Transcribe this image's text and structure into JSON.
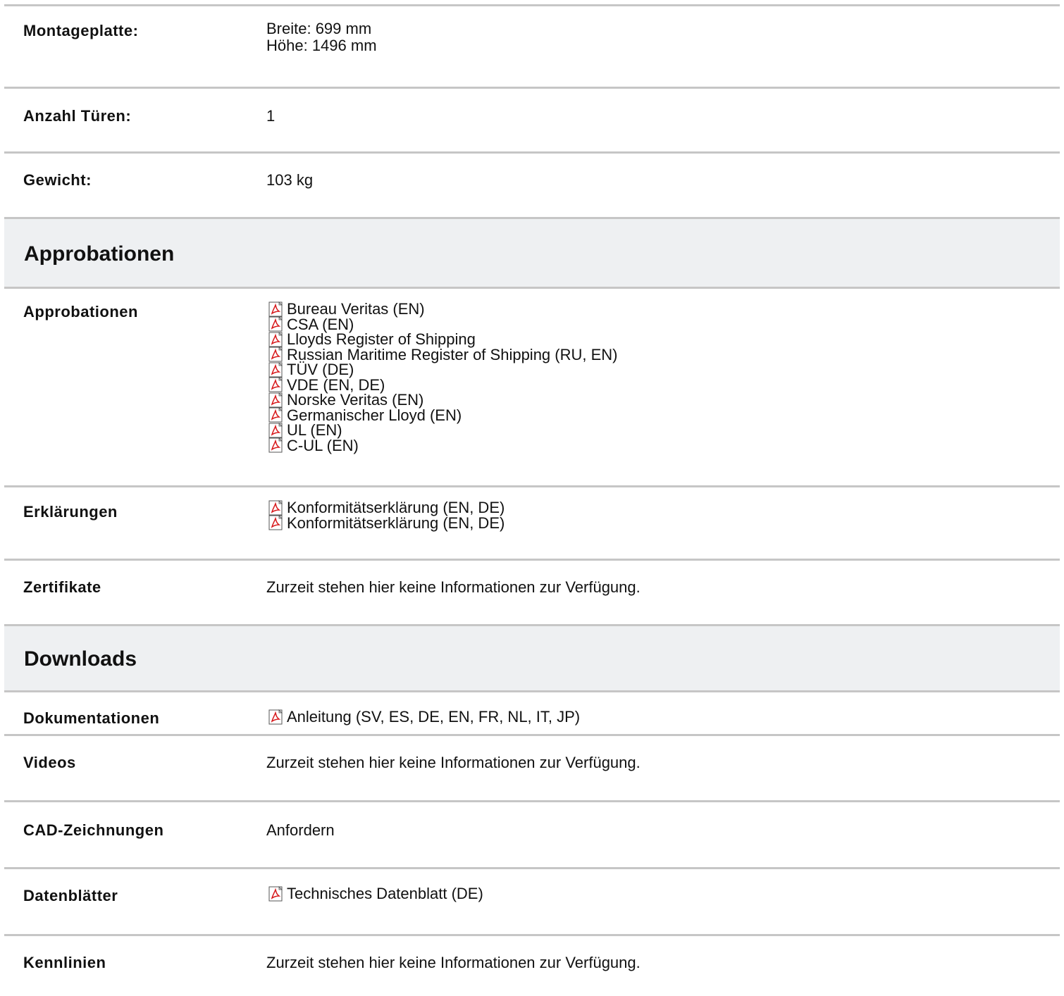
{
  "specs": {
    "mounting_plate": {
      "label": "Montageplatte:",
      "width": "Breite: 699 mm",
      "height": "Höhe: 1496 mm"
    },
    "doors": {
      "label": "Anzahl Türen:",
      "value": "1"
    },
    "weight": {
      "label": "Gewicht:",
      "value": "103 kg"
    }
  },
  "approvals_section": {
    "title": "Approbationen",
    "approvals": {
      "label": "Approbationen",
      "items": [
        "Bureau Veritas (EN)",
        "CSA (EN)",
        "Lloyds Register of Shipping",
        "Russian Maritime Register of Shipping (RU, EN)",
        "TÜV (DE)",
        "VDE (EN, DE)",
        "Norske Veritas (EN)",
        "Germanischer Lloyd (EN)",
        "UL (EN)",
        "C-UL (EN)"
      ]
    },
    "declarations": {
      "label": "Erklärungen",
      "items": [
        "Konformitätserklärung (EN, DE)",
        "Konformitätserklärung (EN, DE)"
      ]
    },
    "certificates": {
      "label": "Zertifikate",
      "value": "Zurzeit stehen hier keine Informationen zur Verfügung."
    }
  },
  "downloads_section": {
    "title": "Downloads",
    "documentation": {
      "label": "Dokumentationen",
      "items": [
        "Anleitung (SV, ES, DE, EN, FR, NL, IT, JP)"
      ]
    },
    "videos": {
      "label": "Videos",
      "value": "Zurzeit stehen hier keine Informationen zur Verfügung."
    },
    "cad": {
      "label": "CAD-Zeichnungen",
      "value": "Anfordern"
    },
    "datasheets": {
      "label": "Datenblätter",
      "items": [
        "Technisches Datenblatt (DE)"
      ]
    },
    "characteristics": {
      "label": "Kennlinien",
      "value": "Zurzeit stehen hier keine Informationen zur Verfügung."
    }
  },
  "icons": {
    "pdf": "pdf-icon",
    "pdf_color": "#d7191c"
  }
}
